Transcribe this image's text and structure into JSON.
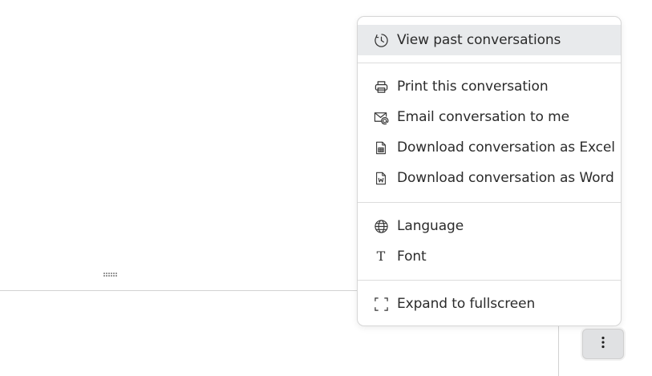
{
  "menu": {
    "items": [
      {
        "label": "View past conversations",
        "icon": "history-clock-icon"
      },
      {
        "label": "Print this conversation",
        "icon": "printer-icon"
      },
      {
        "label": "Email conversation to me",
        "icon": "email-at-icon"
      },
      {
        "label": "Download conversation as Excel",
        "icon": "excel-file-icon"
      },
      {
        "label": "Download conversation as Word",
        "icon": "word-file-icon"
      },
      {
        "label": "Language",
        "icon": "globe-icon"
      },
      {
        "label": "Font",
        "icon": "font-t-icon"
      },
      {
        "label": "Expand to fullscreen",
        "icon": "fullscreen-corners-icon"
      }
    ],
    "active_item": "View past conversations"
  },
  "font_icon_glyph": "T",
  "more_button": {
    "icon": "vertical-ellipsis-icon",
    "glyph": "⋮"
  },
  "colors": {
    "menu_active_bg": "#e8eaec",
    "menu_border": "#d6d6d6",
    "button_bg": "#e0e1e3",
    "text": "#2b2b2b"
  }
}
